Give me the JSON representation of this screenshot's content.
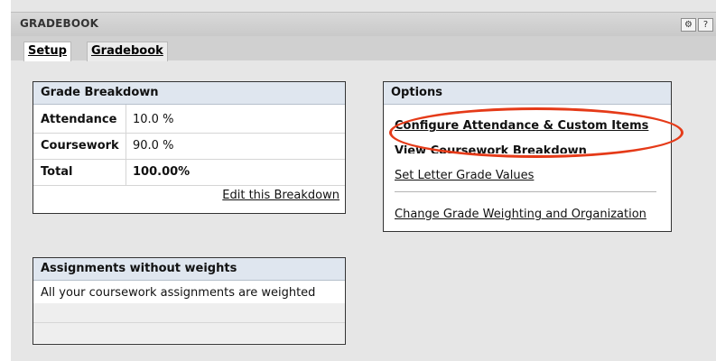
{
  "window": {
    "title": "GRADEBOOK",
    "buttons": [
      {
        "name": "tools",
        "glyph": "⚙"
      },
      {
        "name": "help",
        "glyph": "?"
      }
    ]
  },
  "tabs": [
    {
      "label": "Setup",
      "active": true
    },
    {
      "label": "Gradebook",
      "active": false
    }
  ],
  "grade_breakdown": {
    "title": "Grade Breakdown",
    "rows": [
      {
        "label": "Attendance",
        "value": "10.0 %"
      },
      {
        "label": "Coursework",
        "value": "90.0 %"
      },
      {
        "label": "Total",
        "value": "100.00%"
      }
    ],
    "edit_link": "Edit this Breakdown"
  },
  "options": {
    "title": "Options",
    "links": [
      "Configure Attendance & Custom Items",
      "View Coursework Breakdown",
      "Set Letter Grade Values",
      "Change Grade Weighting and Organization"
    ]
  },
  "assignments": {
    "title": "Assignments without weights",
    "message": "All your coursework assignments are weighted"
  },
  "colors": {
    "highlight_oval": "#e53a18",
    "panel_header": "#dfe6ef"
  }
}
